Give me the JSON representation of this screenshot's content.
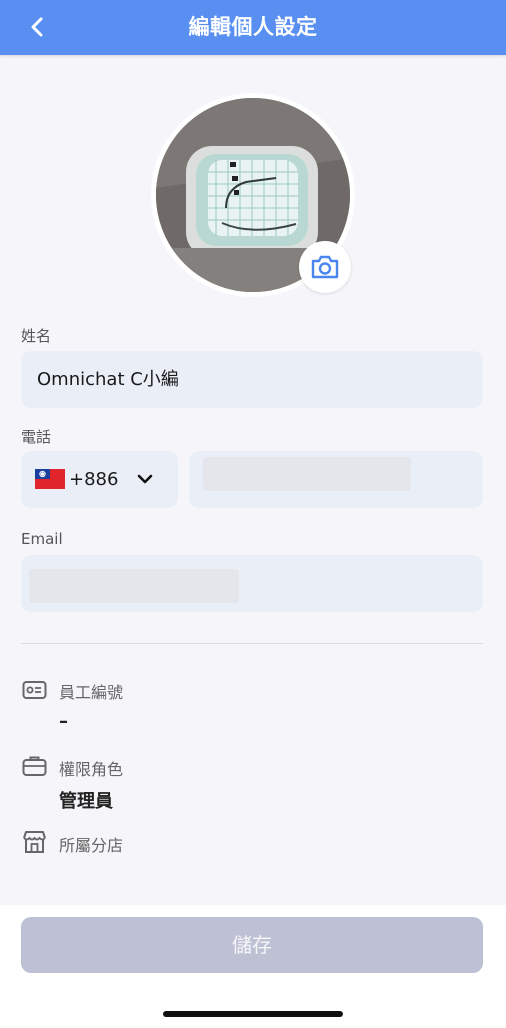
{
  "header": {
    "title": "編輯個人設定",
    "back_icon": "chevron-left-icon"
  },
  "avatar": {
    "camera_icon": "camera-icon"
  },
  "form": {
    "name_label": "姓名",
    "name_value": "Omnichat C小編",
    "phone_label": "電話",
    "phone_country_flag": "taiwan-flag-icon",
    "phone_country_code": "+886",
    "phone_value": "",
    "email_label": "Email",
    "email_value": ""
  },
  "info": {
    "employee_id_label": "員工編號",
    "employee_id_value": "–",
    "role_label": "權限角色",
    "role_value": "管理員",
    "store_label": "所屬分店",
    "store_value": ""
  },
  "footer": {
    "save_label": "儲存"
  },
  "colors": {
    "header_bg": "#5a8ff2",
    "accent": "#4a86ee",
    "field_bg": "#eaeef7",
    "save_disabled_bg": "#bec1d4"
  }
}
